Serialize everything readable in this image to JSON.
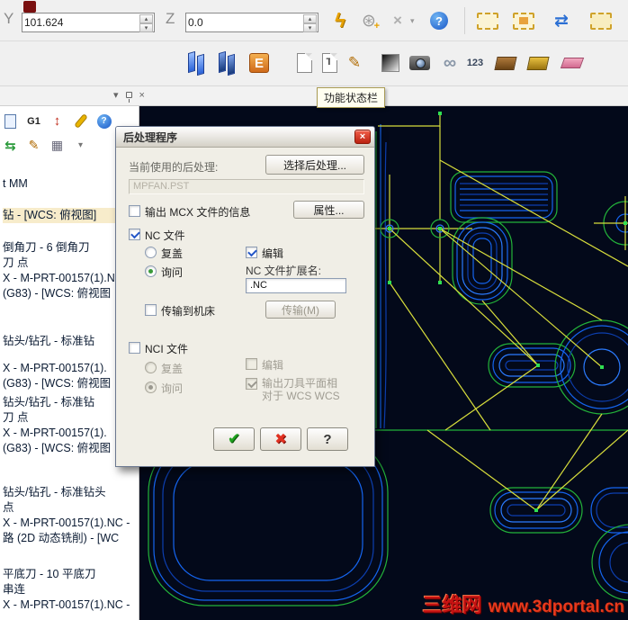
{
  "ribbon": {
    "y_label": "Y",
    "y_value": "101.624",
    "z_label": "Z",
    "z_value": "0.0",
    "status_tooltip": "功能状态栏"
  },
  "icons": {
    "spin_up": "▴",
    "spin_down": "▾",
    "lightning": "ϟ",
    "gear": "⊛",
    "gear_plus": "+",
    "clear": "×",
    "caret": "▾",
    "help": "?",
    "swap": "⇄",
    "e_logo": "E",
    "doc_t": "T",
    "pencil": "✎",
    "torus": "∞",
    "numbers": "123",
    "g1": "G1",
    "axes": "↕",
    "swap_mini": "⇆",
    "grid": "▦",
    "panel_close": "×",
    "ok": "✔",
    "cancel": "✖",
    "question": "?",
    "close": "×"
  },
  "panel": {
    "tree_items": [
      "t MM",
      "钻 - [WCS: 俯视图]",
      "倒角刀 - 6 倒角刀",
      "刀 点",
      "X - M-PRT-00157(1).N",
      "(G83) - [WCS: 俯视图",
      "钻头/钻孔 - 标准钻",
      "X - M-PRT-00157(1).",
      "(G83) - [WCS: 俯视图",
      "钻头/钻孔 - 标准钻",
      "刀 点",
      "X - M-PRT-00157(1).",
      "(G83) - [WCS: 俯视图",
      "钻头/钻孔 - 标准钻头",
      "点",
      "X - M-PRT-00157(1).NC -",
      "路 (2D 动态铣削) - [WC",
      "平底刀 - 10 平底刀",
      "串连",
      "X - M-PRT-00157(1).NC -"
    ]
  },
  "dialog": {
    "title": "后处理程序",
    "current_post_label": "当前使用的后处理:",
    "select_post_button": "选择后处理...",
    "post_file": "MPFAN.PST",
    "output_mcx_label": "输出 MCX 文件的信息",
    "properties_button": "属性...",
    "nc_file_label": "NC 文件",
    "overwrite_label": "复盖",
    "prompt_label": "询问",
    "edit_label": "编辑",
    "nc_ext_label": "NC 文件扩展名:",
    "nc_ext_value": ".NC",
    "transfer_label": "传输到机床",
    "transfer_button": "传输(M)",
    "nci_file_label": "NCI 文件",
    "nci_overwrite_label": "复盖",
    "nci_prompt_label": "询问",
    "nci_edit_label": "编辑",
    "tool_plane_line1": "输出刀具平面相",
    "tool_plane_line2": "对于 WCS WCS"
  },
  "viewport": {
    "watermark_site_name": "三维网",
    "watermark_url": "www.3dportal.cn"
  },
  "colors": {
    "toolpath_blue": "#1565f0",
    "geometry_green": "#23b33a",
    "rapid_yellow": "#d8de3c",
    "viewport_bg": "#03091a",
    "watermark_red": "#c61212"
  }
}
